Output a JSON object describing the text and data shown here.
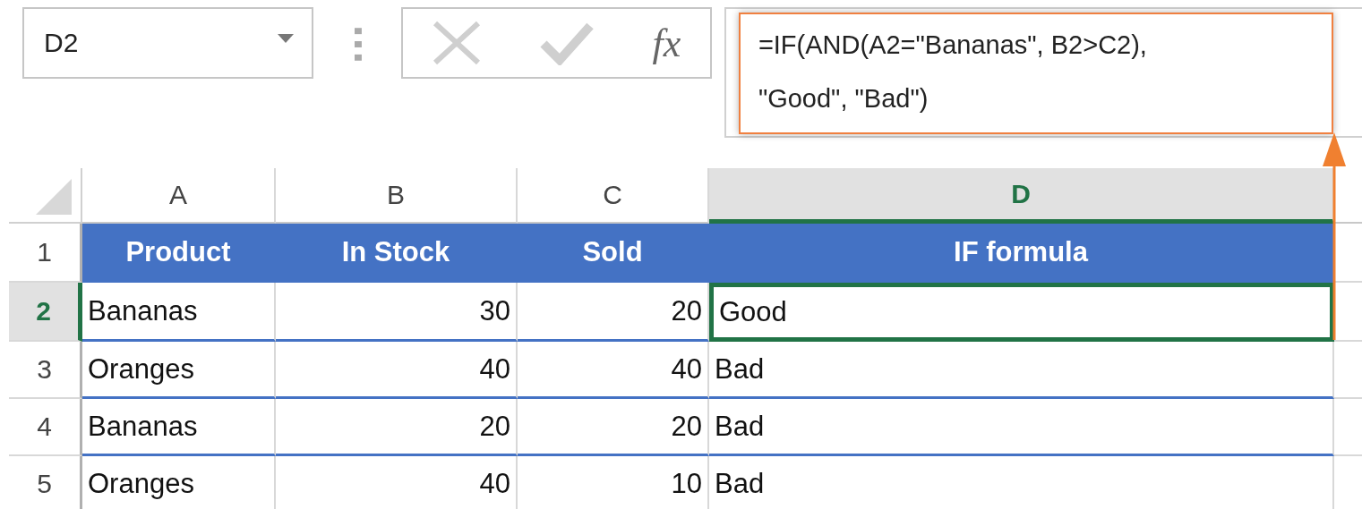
{
  "name_box": {
    "value": "D2"
  },
  "formula_buttons": {
    "insert_function": "fx"
  },
  "formula_bar": {
    "formula": "=IF(AND(A2=\"Bananas\", B2>C2),\n\"Good\", \"Bad\")"
  },
  "columns": [
    {
      "label": "A",
      "selected": false
    },
    {
      "label": "B",
      "selected": false
    },
    {
      "label": "C",
      "selected": false
    },
    {
      "label": "D",
      "selected": true
    }
  ],
  "rows": [
    {
      "number": "1",
      "selected": false,
      "kind": "header",
      "cells": [
        "Product",
        "In Stock",
        "Sold",
        "IF formula"
      ]
    },
    {
      "number": "2",
      "selected": true,
      "kind": "data",
      "cells": [
        "Bananas",
        "30",
        "20",
        "Good"
      ]
    },
    {
      "number": "3",
      "selected": false,
      "kind": "data",
      "cells": [
        "Oranges",
        "40",
        "40",
        "Bad"
      ]
    },
    {
      "number": "4",
      "selected": false,
      "kind": "data",
      "cells": [
        "Bananas",
        "20",
        "20",
        "Bad"
      ]
    },
    {
      "number": "5",
      "selected": false,
      "kind": "data",
      "cells": [
        "Oranges",
        "40",
        "10",
        "Bad"
      ]
    }
  ]
}
